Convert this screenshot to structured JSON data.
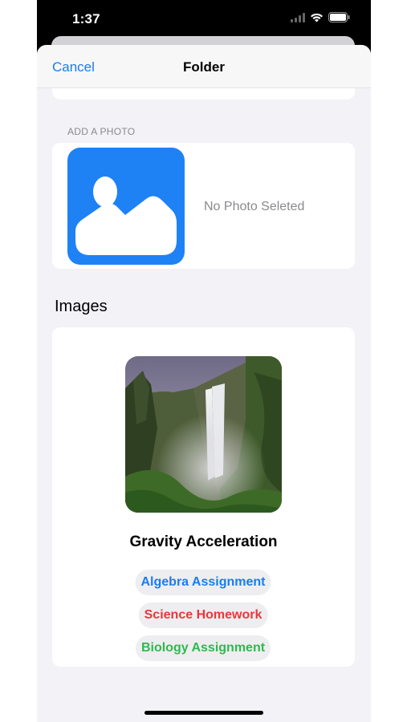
{
  "status_bar": {
    "time": "1:37",
    "icons": [
      "signal-icon",
      "wifi-icon",
      "battery-icon"
    ]
  },
  "navbar": {
    "cancel_label": "Cancel",
    "title": "Folder"
  },
  "photo_section": {
    "header": "ADD A PHOTO",
    "placeholder_icon": "photo-placeholder-icon",
    "empty_text": "No Photo Seleted"
  },
  "images_section": {
    "title": "Images",
    "item": {
      "image": "waterfall-photo",
      "title": "Gravity Acceleration",
      "tags": [
        {
          "label": "Algebra Assignment",
          "color": "#1a7cf2"
        },
        {
          "label": "Science Homework",
          "color": "#e8383b"
        },
        {
          "label": "Biology Assignment",
          "color": "#30b84f"
        }
      ]
    }
  },
  "colors": {
    "accent": "#1a7cf2",
    "background": "#f2f2f7",
    "card": "#ffffff"
  }
}
